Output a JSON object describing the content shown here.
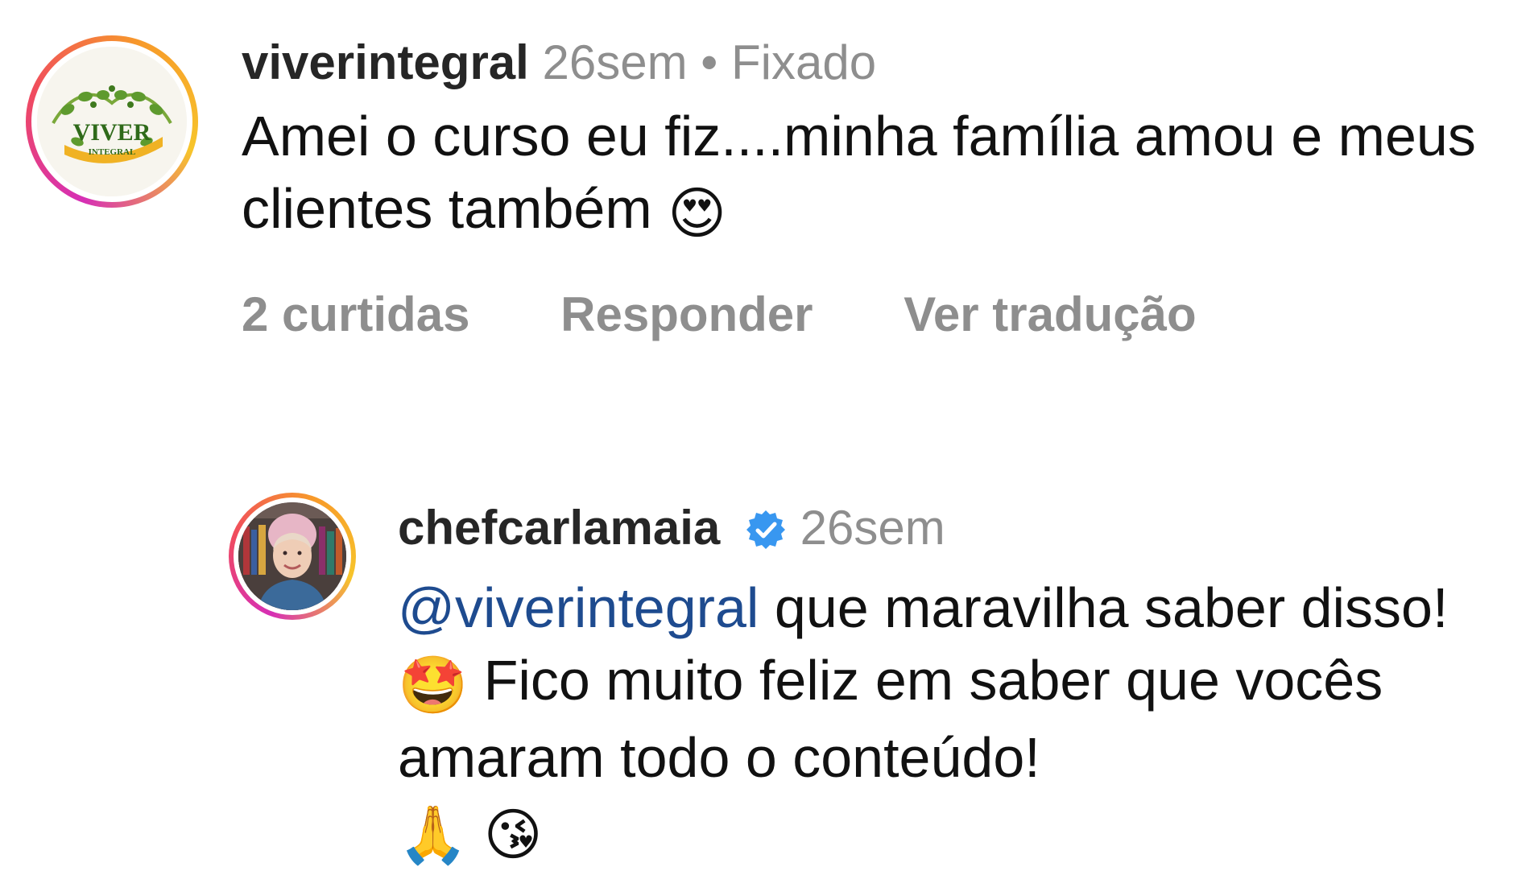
{
  "comments": [
    {
      "username": "viverintegral",
      "time": "26sem",
      "separator": "•",
      "pinned_label": "Fixado",
      "text": "Amei o curso eu fiz....minha família  amou e meus clientes  também",
      "emoji": "😍",
      "avatar_logo_text": "VIVER",
      "avatar_logo_subtext": "INTEGRAL",
      "actions": {
        "likes": "2 curtidas",
        "reply": "Responder",
        "translate": "Ver tradução"
      }
    },
    {
      "username": "chefcarlamaia",
      "verified_icon": "verified-badge-icon",
      "time": "26sem",
      "mention": "@viverintegral",
      "text_part1": " que maravilha saber disso! ",
      "emoji1": "🤩",
      "text_part2": " Fico muito feliz em saber que vocês amaram todo o conteúdo!",
      "emoji2": "🙏",
      "emoji3": "😘"
    }
  ],
  "colors": {
    "username": "#262626",
    "meta": "#8e8e8e",
    "mention": "#1e4b8f",
    "verified": "#3897f0",
    "ring_start": "#d62fb5",
    "ring_end": "#f7c52b"
  }
}
